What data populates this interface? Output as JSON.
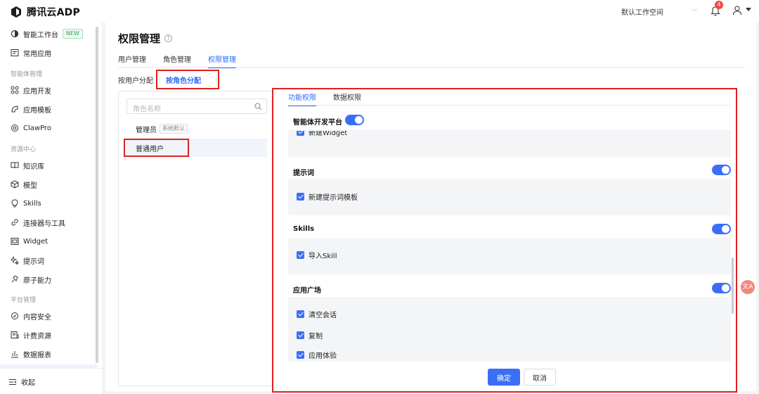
{
  "app": {
    "title": "腾讯云ADP"
  },
  "topbar": {
    "workspace": "默认工作空间",
    "notification_count": "4"
  },
  "sidebar": {
    "items": [
      {
        "label": "智能工作台",
        "tag": "NEW",
        "icon": "workbench-icon"
      },
      {
        "label": "常用应用",
        "icon": "apps-icon"
      },
      {
        "group": "智能体管理"
      },
      {
        "label": "应用开发",
        "icon": "grid-icon"
      },
      {
        "label": "应用模板",
        "icon": "template-icon"
      },
      {
        "label": "ClawPro",
        "icon": "claw-icon"
      },
      {
        "group": "资源中心"
      },
      {
        "label": "知识库",
        "icon": "book-icon"
      },
      {
        "label": "模型",
        "icon": "cube-icon"
      },
      {
        "label": "Skills",
        "icon": "bulb-icon"
      },
      {
        "label": "连接器与工具",
        "icon": "link-icon"
      },
      {
        "label": "Widget",
        "icon": "widget-icon"
      },
      {
        "label": "提示词",
        "icon": "sparkle-icon"
      },
      {
        "label": "原子能力",
        "icon": "atom-icon"
      },
      {
        "group": "平台管理"
      },
      {
        "label": "内容安全",
        "icon": "shield-icon"
      },
      {
        "label": "计费资源",
        "icon": "billing-icon"
      },
      {
        "label": "数据报表",
        "icon": "chart-icon"
      }
    ],
    "collapse_label": "收起"
  },
  "page": {
    "title": "权限管理",
    "tabs": [
      "用户管理",
      "角色管理",
      "权限管理"
    ],
    "active_tab": "权限管理",
    "subtabs": [
      "按用户分配",
      "按角色分配"
    ],
    "active_subtab": "按角色分配"
  },
  "roles": {
    "search_placeholder": "角色名称",
    "list": [
      {
        "name": "管理员",
        "tag": "系统默认"
      },
      {
        "name": "普通用户"
      }
    ],
    "selected": "普通用户"
  },
  "permissions": {
    "tabs": [
      "功能权限",
      "数据权限"
    ],
    "active_tab": "功能权限",
    "platform": {
      "label": "智能体开发平台",
      "enabled": true
    },
    "cut_item": "新建Widget",
    "sections": [
      {
        "label": "提示词",
        "enabled": true,
        "items": [
          "新建提示词模板"
        ]
      },
      {
        "label": "Skills",
        "enabled": true,
        "items": [
          "导入Skill"
        ]
      },
      {
        "label": "应用广场",
        "enabled": true,
        "items": [
          "清空会话",
          "复制",
          "应用体验"
        ]
      }
    ],
    "confirm_label": "确定",
    "cancel_label": "取消"
  },
  "colors": {
    "primary": "#3a6ff5",
    "highlight_box": "#e02020"
  },
  "translate_icon": "文A"
}
